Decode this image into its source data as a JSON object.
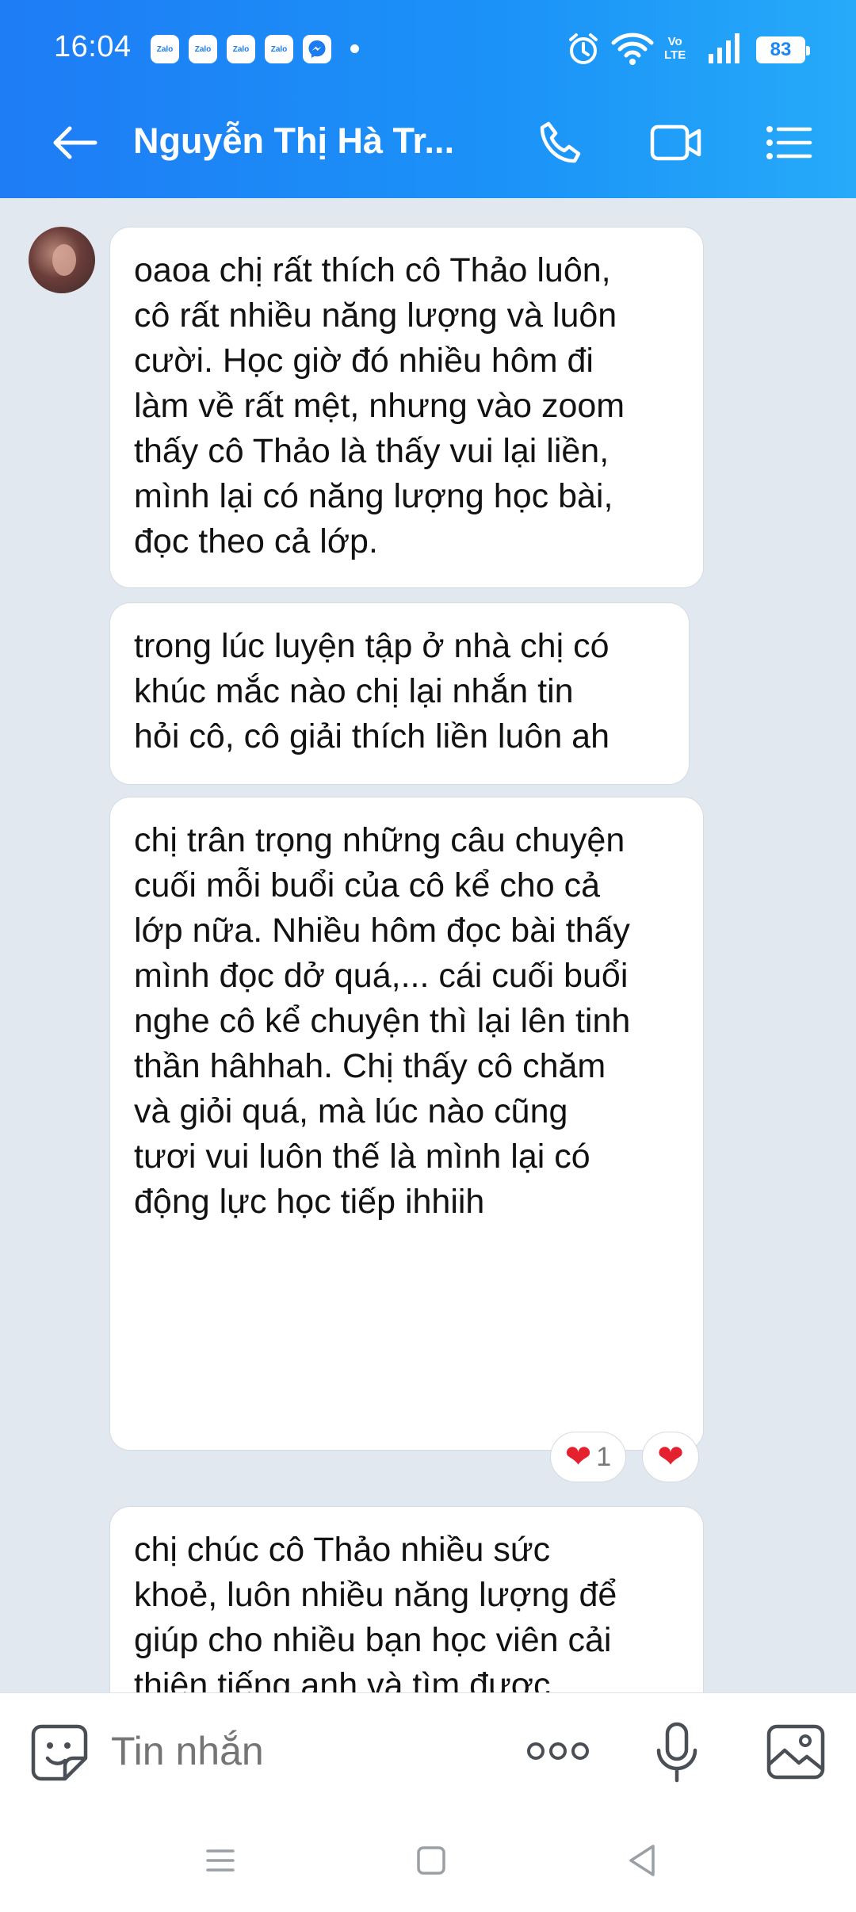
{
  "status_bar": {
    "time": "16:04",
    "notification_icons": [
      "Zalo",
      "Zalo",
      "Zalo",
      "Zalo"
    ],
    "network_label": "Vo\nLTE",
    "battery": "83"
  },
  "header": {
    "back_icon": "arrow-left-icon",
    "title": "Nguyễn Thị Hà Tr...",
    "actions": [
      "phone-icon",
      "video-call-icon",
      "menu-icon"
    ]
  },
  "messages": [
    {
      "text": "oaoa chị rất thích cô Thảo luôn,\ncô rất nhiều năng lượng và luôn\ncười. Học giờ đó nhiều hôm đi\nlàm về rất mệt, nhưng vào zoom\nthấy cô Thảo là thấy vui lại liền,\nmình lại có năng lượng học bài,\nđọc theo cả lớp."
    },
    {
      "text": "trong lúc luyện tập ở nhà chị có\nkhúc mắc nào chị lại nhắn tin\nhỏi cô, cô giải thích liền luôn ah"
    },
    {
      "text": "chị trân trọng những câu chuyện\ncuối mỗi buổi của cô kể cho cả\nlớp nữa. Nhiều hôm đọc bài thấy\nmình đọc dở quá,... cái cuối buổi\nnghe cô kể chuyện thì lại lên tinh\nthần hâhhah. Chị thấy cô chăm\nvà giỏi quá, mà lúc nào cũng\ntươi vui luôn thế là mình lại có\nđộng lực học tiếp ihhiih"
    },
    {
      "text": "chị chúc cô Thảo nhiều sức\nkhoẻ, luôn nhiều năng lượng để\ngiúp cho nhiều bạn học viên cải\nthiện tiếng anh và tìm được\nniềm vui khi học ^ ^ chị chúc cô\nThảo luôn vui khoẻ và đạt được\nnhững mục tiêu trong cuộc sống\ncủa cô nữa 😍"
    }
  ],
  "reactions": {
    "heart_count": "1",
    "heart": "❤"
  },
  "input": {
    "placeholder": "Tin nhắn"
  },
  "colors": {
    "header_start": "#1e7cf5",
    "header_end": "#26aaf9",
    "chat_bg": "#e2e8ef",
    "heart": "#e52130"
  }
}
